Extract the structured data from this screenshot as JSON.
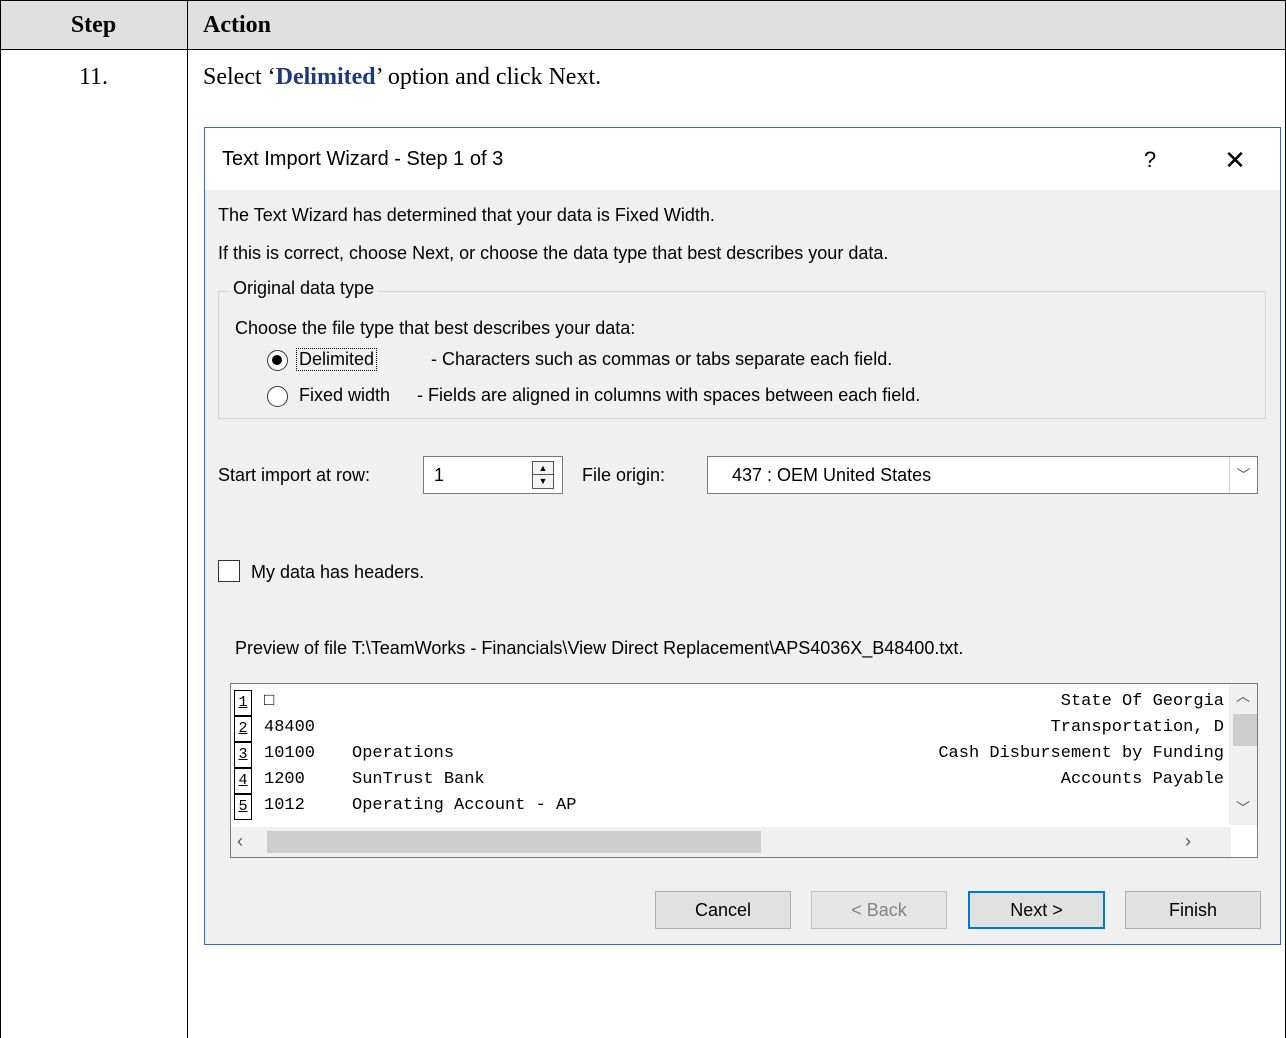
{
  "table": {
    "header_step": "Step",
    "header_action": "Action",
    "step_number": "11.",
    "instruction_pre": "Select ‘",
    "instruction_keyword": "Delimited",
    "instruction_post": "’ option and click Next."
  },
  "dialog": {
    "title": "Text Import Wizard - Step 1 of 3",
    "help_glyph": "?",
    "close_glyph": "✕",
    "line1": "The Text Wizard has determined that your data is Fixed Width.",
    "line2": "If this is correct, choose Next, or choose the data type that best describes your data.",
    "group_title": "Original data type",
    "choose_label": "Choose the file type that best describes your data:",
    "options": [
      {
        "label": "Delimited",
        "desc": "- Characters such as commas or tabs separate each field.",
        "selected": true
      },
      {
        "label": "Fixed width",
        "desc": "- Fields are aligned in columns with spaces between each field.",
        "selected": false
      }
    ],
    "start_row_label": "Start import at row:",
    "start_row_value": "1",
    "file_origin_label": "File origin:",
    "file_origin_value": "437 : OEM United States",
    "headers_checkbox_label": "My data has headers.",
    "headers_checked": false,
    "preview_label": "Preview of file T:\\TeamWorks - Financials\\View Direct Replacement\\APS4036X_B48400.txt.",
    "preview_rows": [
      {
        "num": "1",
        "c1": "□",
        "c2": "",
        "c3": "State Of Georgia"
      },
      {
        "num": "2",
        "c1": "48400",
        "c2": "",
        "c3": "Transportation, D"
      },
      {
        "num": "3",
        "c1": "10100",
        "c2": "Operations",
        "c3": "Cash Disbursement by Funding"
      },
      {
        "num": "4",
        "c1": "1200",
        "c2": "SunTrust Bank",
        "c3": "Accounts Payable"
      },
      {
        "num": "5",
        "c1": "1012",
        "c2": "Operating Account - AP",
        "c3": ""
      }
    ],
    "buttons": {
      "cancel": "Cancel",
      "back": "< Back",
      "next": "Next >",
      "finish": "Finish"
    }
  },
  "colors": {
    "header_bg": "#e0e0e0",
    "keyword": "#1f3a7a",
    "dialog_border": "#2b6cc4",
    "default_button_border": "#0078d7"
  }
}
